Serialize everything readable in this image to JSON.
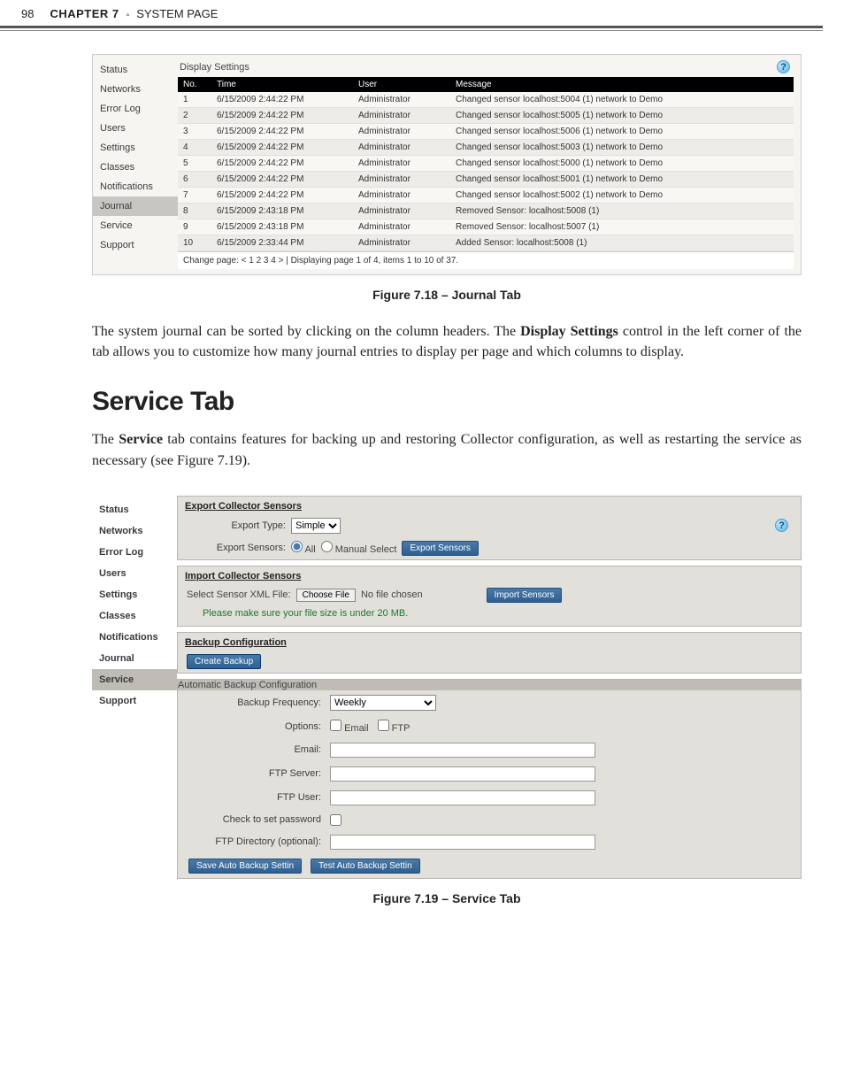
{
  "header": {
    "pagenum": "98",
    "chapter": "CHAPTER 7",
    "title": "SYSTEM PAGE"
  },
  "sidebar": {
    "items": [
      "Status",
      "Networks",
      "Error Log",
      "Users",
      "Settings",
      "Classes",
      "Notifications",
      "Journal",
      "Service",
      "Support"
    ]
  },
  "journal": {
    "display_settings": "Display Settings",
    "headers": {
      "no": "No.",
      "time": "Time",
      "user": "User",
      "message": "Message"
    },
    "rows": [
      {
        "no": "1",
        "time": "6/15/2009 2:44:22 PM",
        "user": "Administrator",
        "msg": "Changed sensor localhost:5004 (1) network to Demo"
      },
      {
        "no": "2",
        "time": "6/15/2009 2:44:22 PM",
        "user": "Administrator",
        "msg": "Changed sensor localhost:5005 (1) network to Demo"
      },
      {
        "no": "3",
        "time": "6/15/2009 2:44:22 PM",
        "user": "Administrator",
        "msg": "Changed sensor localhost:5006 (1) network to Demo"
      },
      {
        "no": "4",
        "time": "6/15/2009 2:44:22 PM",
        "user": "Administrator",
        "msg": "Changed sensor localhost:5003 (1) network to Demo"
      },
      {
        "no": "5",
        "time": "6/15/2009 2:44:22 PM",
        "user": "Administrator",
        "msg": "Changed sensor localhost:5000 (1) network to Demo"
      },
      {
        "no": "6",
        "time": "6/15/2009 2:44:22 PM",
        "user": "Administrator",
        "msg": "Changed sensor localhost:5001 (1) network to Demo"
      },
      {
        "no": "7",
        "time": "6/15/2009 2:44:22 PM",
        "user": "Administrator",
        "msg": "Changed sensor localhost:5002 (1) network to Demo"
      },
      {
        "no": "8",
        "time": "6/15/2009 2:43:18 PM",
        "user": "Administrator",
        "msg": "Removed Sensor: localhost:5008 (1)"
      },
      {
        "no": "9",
        "time": "6/15/2009 2:43:18 PM",
        "user": "Administrator",
        "msg": "Removed Sensor: localhost:5007 (1)"
      },
      {
        "no": "10",
        "time": "6/15/2009 2:33:44 PM",
        "user": "Administrator",
        "msg": "Added Sensor: localhost:5008 (1)"
      }
    ],
    "pager": "Change page: < 1 2 3 4 >  |  Displaying page 1 of 4, items 1 to 10 of 37."
  },
  "fig718_caption": "Figure 7.18 – Journal Tab",
  "para1": "The system journal can be sorted by clicking on the column headers. The Display Settings control in the left corner of the tab allows you to customize how many journal entries to display per page and which columns to display.",
  "section_title": "Service Tab",
  "para2": "The Service tab contains features for backing up and restoring Collector configuration, as well as restarting the service as necessary (see Figure 7.19).",
  "service": {
    "export_title": "Export Collector Sensors",
    "export_type_label": "Export Type:",
    "export_type_value": "Simple",
    "export_sensors_label": "Export Sensors:",
    "radio_all": "All",
    "radio_manual": "Manual Select",
    "export_btn": "Export Sensors",
    "import_title": "Import Collector Sensors",
    "select_xml_label": "Select Sensor XML File:",
    "choose_file": "Choose File",
    "no_file": "No file chosen",
    "import_btn": "Import Sensors",
    "green_note": "Please make sure your file size is under 20 MB.",
    "backup_title": "Backup Configuration",
    "create_backup": "Create Backup",
    "auto_title": "Automatic Backup Configuration",
    "freq_label": "Backup Frequency:",
    "freq_value": "Weekly",
    "options_label": "Options:",
    "opt_email": "Email",
    "opt_ftp": "FTP",
    "email_label": "Email:",
    "ftpserver_label": "FTP Server:",
    "ftpuser_label": "FTP User:",
    "check_pw": "Check to set password",
    "ftpdir_label": "FTP Directory (optional):",
    "save_btn": "Save Auto Backup Settin",
    "test_btn": "Test Auto Backup Settin"
  },
  "fig719_caption": "Figure 7.19 – Service Tab"
}
